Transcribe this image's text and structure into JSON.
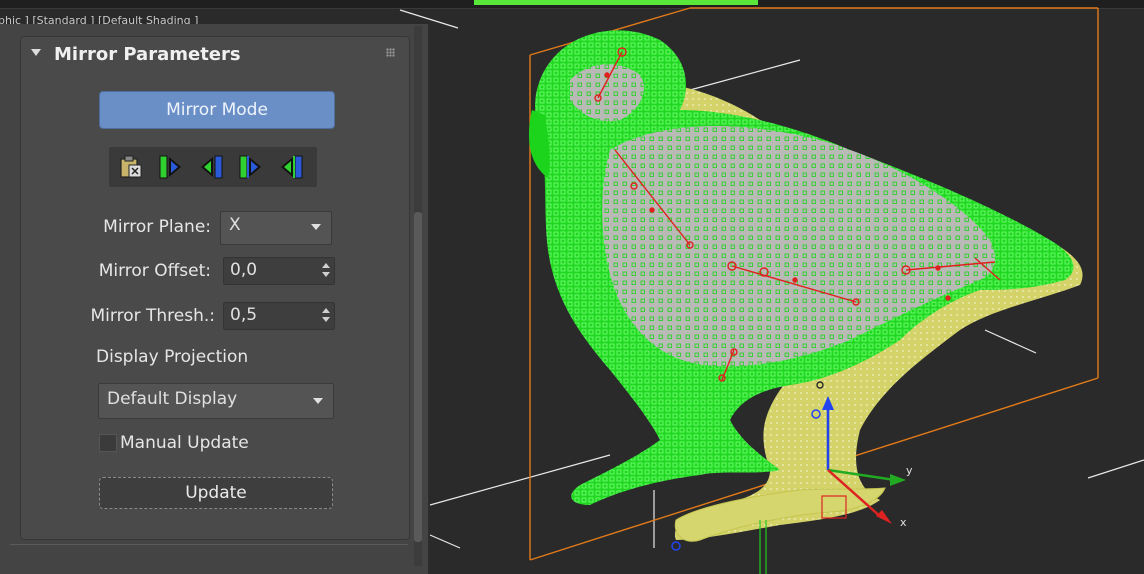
{
  "viewport": {
    "label": "phic ] [Standard ] [Default Shading ]",
    "axis_labels": {
      "x": "x",
      "y": "y"
    }
  },
  "rollout": {
    "title": "Mirror Parameters",
    "mirror_mode_label": "Mirror Mode",
    "toolbar_icons": [
      "paste-mirror-icon",
      "mirror-right-green-icon",
      "mirror-left-green-icon",
      "mirror-right-blue-icon",
      "mirror-left-blue-icon"
    ],
    "mirror_plane": {
      "label": "Mirror Plane:",
      "value": "X"
    },
    "mirror_offset": {
      "label": "Mirror Offset:",
      "value": "0,0"
    },
    "mirror_thresh": {
      "label": "Mirror Thresh.:",
      "value": "0,5"
    },
    "display_projection": {
      "label": "Display Projection",
      "value": "Default Display"
    },
    "manual_update": {
      "label": "Manual Update",
      "checked": false
    },
    "update_label": "Update"
  },
  "colors": {
    "accent_button": "#6a8fc7",
    "selected_vertices": "#22ff22",
    "unselected_vertices": "#d8d860",
    "bone_lines": "#e02020",
    "gizmo_orange": "#e07a1a"
  }
}
